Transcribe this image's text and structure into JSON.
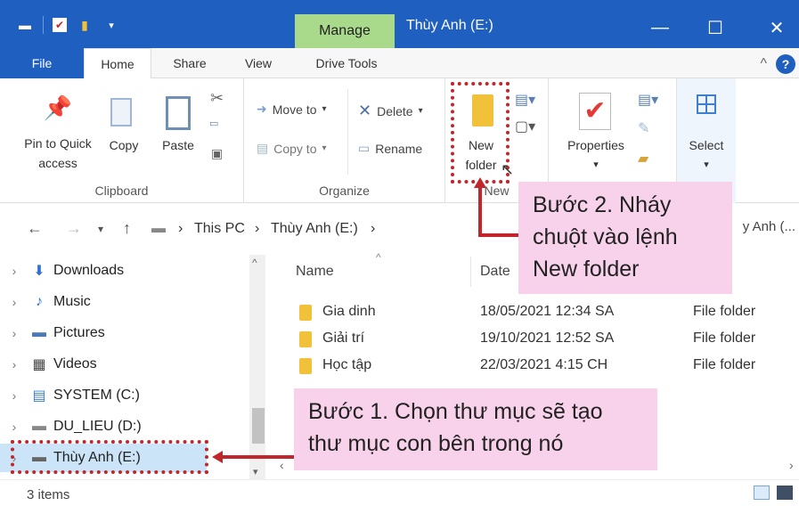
{
  "window": {
    "title": "Thùy Anh (E:)",
    "manage_tab": "Manage",
    "minimize": "—",
    "maximize": "☐",
    "close": "✕"
  },
  "tabs": {
    "file": "File",
    "home": "Home",
    "share": "Share",
    "view": "View",
    "drive_tools": "Drive Tools",
    "collapse": "^",
    "help": "?"
  },
  "ribbon": {
    "clipboard": {
      "label": "Clipboard",
      "pin_line1": "Pin to Quick",
      "pin_line2": "access",
      "copy": "Copy",
      "paste": "Paste"
    },
    "organize": {
      "label": "Organize",
      "move_to": "Move to",
      "copy_to": "Copy to",
      "delete": "Delete",
      "rename": "Rename"
    },
    "new": {
      "label": "New",
      "new_line1": "New",
      "new_line2": "folder"
    },
    "open": {
      "properties": "Properties"
    },
    "select": {
      "select": "Select"
    }
  },
  "address": {
    "this_pc": "This PC",
    "drive": "Thùy Anh (E:)",
    "search_placeholder": "y Anh (..."
  },
  "nav": {
    "items": [
      {
        "label": "Downloads",
        "icon": "download-icon"
      },
      {
        "label": "Music",
        "icon": "music-icon"
      },
      {
        "label": "Pictures",
        "icon": "pictures-icon"
      },
      {
        "label": "Videos",
        "icon": "videos-icon"
      },
      {
        "label": "SYSTEM (C:)",
        "icon": "drive-icon"
      },
      {
        "label": "DU_LIEU (D:)",
        "icon": "drive-icon"
      },
      {
        "label": "Thùy Anh (E:)",
        "icon": "drive-icon"
      }
    ]
  },
  "list": {
    "col_name": "Name",
    "col_date": "Date",
    "rows": [
      {
        "name": "Gia dinh",
        "date": "18/05/2021 12:34 SA",
        "type": "File folder"
      },
      {
        "name": "Giải trí",
        "date": "19/10/2021 12:52 SA",
        "type": "File folder"
      },
      {
        "name": "Học tập",
        "date": "22/03/2021 4:15 CH",
        "type": "File folder"
      }
    ]
  },
  "status": {
    "count": "3 items"
  },
  "callouts": {
    "step2_line1": "Bước 2. Nháy",
    "step2_line2": "chuột vào lệnh",
    "step2_line3": "New folder",
    "step1_line1": "Bước 1. Chọn thư mục sẽ tạo",
    "step1_line2": "thư mục con bên trong nó"
  },
  "colors": {
    "title_blue": "#1f5fbf",
    "manage_green": "#a9d98a",
    "callout_pink": "#f8d2ea",
    "annotation_red": "#c0262b"
  }
}
